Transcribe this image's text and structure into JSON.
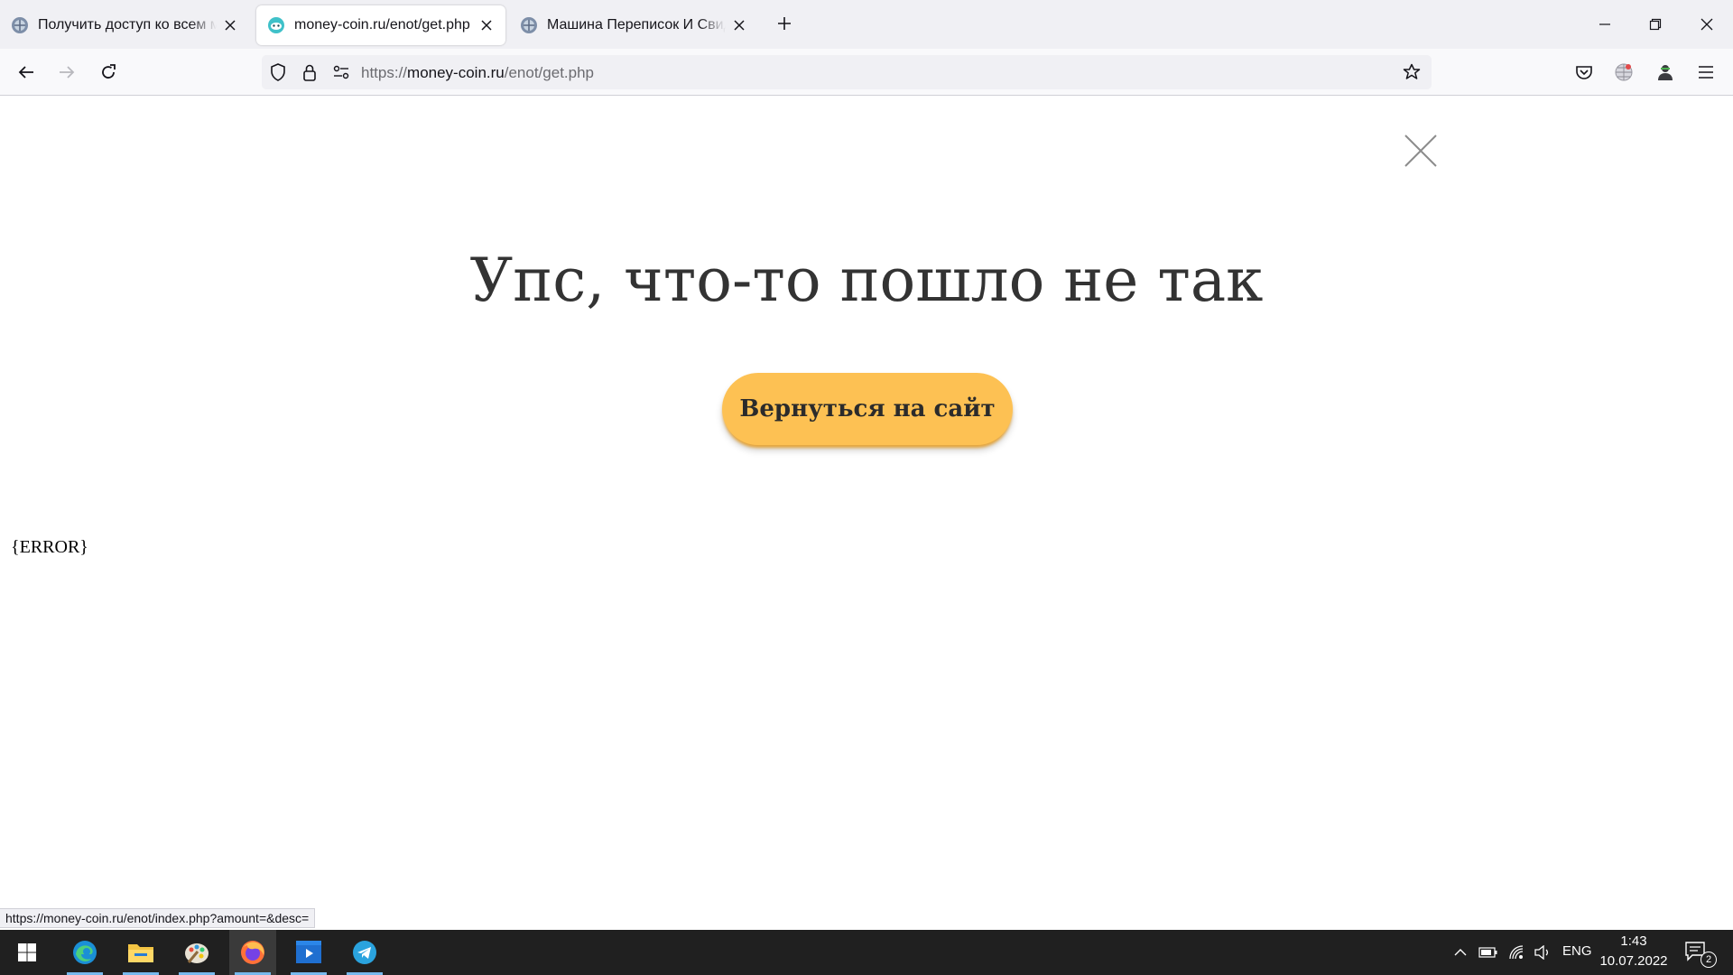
{
  "browser": {
    "tabs": [
      {
        "title": "Получить доступ ко всем мате",
        "favicon": "globe-favicon-icon",
        "active": false
      },
      {
        "title": "money-coin.ru/enot/get.php",
        "favicon": "enot-favicon-icon",
        "active": true
      },
      {
        "title": "Машина Переписок И Свидан",
        "favicon": "globe-favicon-icon",
        "active": false
      }
    ],
    "new_tab_icon": "plus-icon",
    "window_controls": [
      "minimize-icon",
      "restore-icon",
      "close-icon"
    ],
    "url": {
      "scheme": "https://",
      "host": "money-coin.ru",
      "path": "/enot/get.php"
    },
    "nav_icons": [
      "back-arrow-icon",
      "forward-arrow-icon",
      "reload-icon",
      "shield-icon",
      "lock-icon",
      "permissions-icon",
      "bookmark-star-icon",
      "pocket-icon",
      "extension-icon",
      "profile-icon",
      "menu-icon"
    ]
  },
  "page": {
    "heading": "Упс, что-то пошло не так",
    "button_label": "Вернуться на сайт",
    "error_placeholder": "{ERROR}",
    "status_link": "https://money-coin.ru/enot/index.php?amount=&desc=",
    "colors": {
      "button": "#fdc153",
      "heading": "#333333"
    }
  },
  "taskbar": {
    "apps": [
      "start-icon",
      "edge-icon",
      "file-explorer-icon",
      "paint-icon",
      "firefox-icon",
      "media-player-icon",
      "telegram-icon"
    ],
    "language": "ENG",
    "time": "1:43",
    "date": "10.07.2022",
    "notification_count": "2"
  }
}
